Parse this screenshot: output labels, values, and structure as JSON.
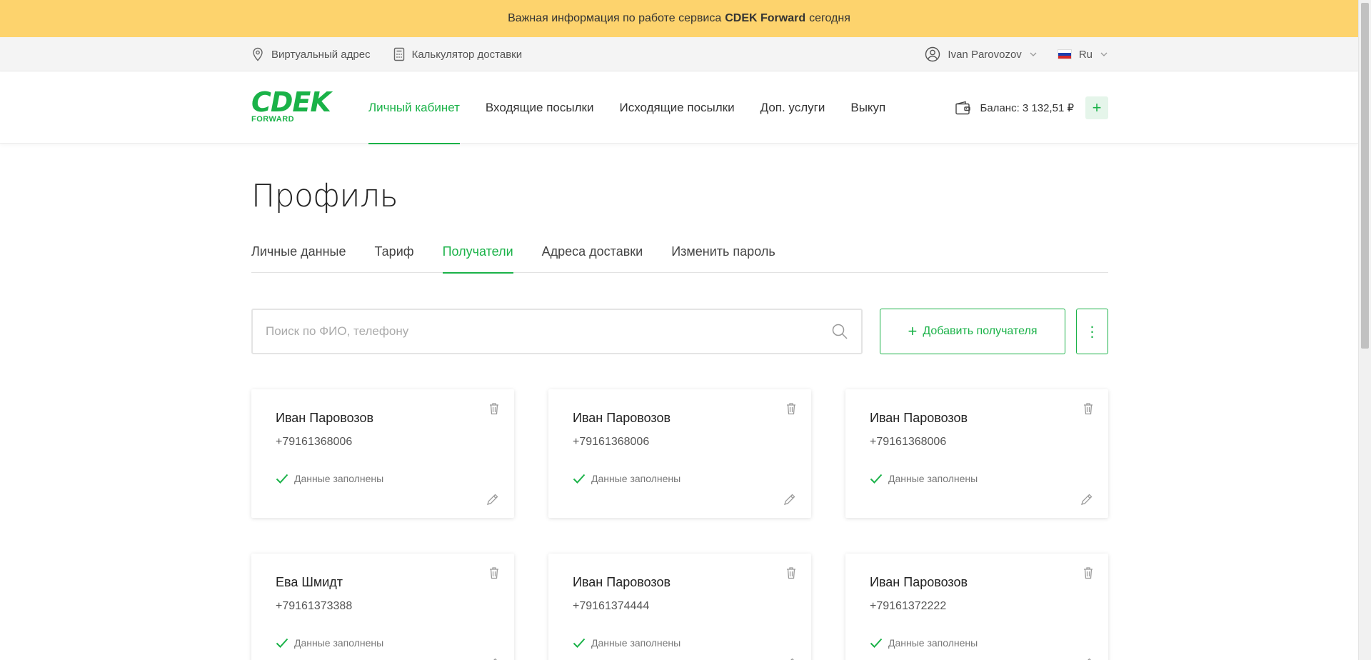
{
  "banner": {
    "prefix": "Важная информация по работе сервиса",
    "brand": "CDEK Forward",
    "suffix": "сегодня"
  },
  "util": {
    "virtual_address": "Виртуальный адрес",
    "calculator": "Калькулятор доставки",
    "user": "Ivan Parovozov",
    "lang": "Ru"
  },
  "logo": {
    "word": "CDEK",
    "sub": "FORWARD"
  },
  "nav": [
    {
      "label": "Личный кабинет",
      "active": true
    },
    {
      "label": "Входящие посылки",
      "active": false
    },
    {
      "label": "Исходящие посылки",
      "active": false
    },
    {
      "label": "Доп. услуги",
      "active": false
    },
    {
      "label": "Выкуп",
      "active": false
    }
  ],
  "balance": {
    "label": "Баланс: 3 132,51 ₽",
    "add": "+"
  },
  "page": {
    "title": "Профиль"
  },
  "tabs": [
    {
      "label": "Личные данные",
      "active": false
    },
    {
      "label": "Тариф",
      "active": false
    },
    {
      "label": "Получатели",
      "active": true
    },
    {
      "label": "Адреса доставки",
      "active": false
    },
    {
      "label": "Изменить пароль",
      "active": false
    }
  ],
  "search": {
    "placeholder": "Поиск по ФИО, телефону",
    "value": ""
  },
  "actions": {
    "add_recipient": "Добавить получателя",
    "add_icon": "+",
    "more": "⋮"
  },
  "recipients": [
    {
      "name": "Иван Паровозов",
      "phone": "+79161368006",
      "status": "Данные заполнены"
    },
    {
      "name": "Иван Паровозов",
      "phone": "+79161368006",
      "status": "Данные заполнены"
    },
    {
      "name": "Иван Паровозов",
      "phone": "+79161368006",
      "status": "Данные заполнены"
    },
    {
      "name": "Ева Шмидт",
      "phone": "+79161373388",
      "status": "Данные заполнены"
    },
    {
      "name": "Иван Паровозов",
      "phone": "+79161374444",
      "status": "Данные заполнены"
    },
    {
      "name": "Иван Паровозов",
      "phone": "+79161372222",
      "status": "Данные заполнены"
    }
  ],
  "colors": {
    "accent": "#1ab248",
    "banner": "#fdd36d"
  }
}
